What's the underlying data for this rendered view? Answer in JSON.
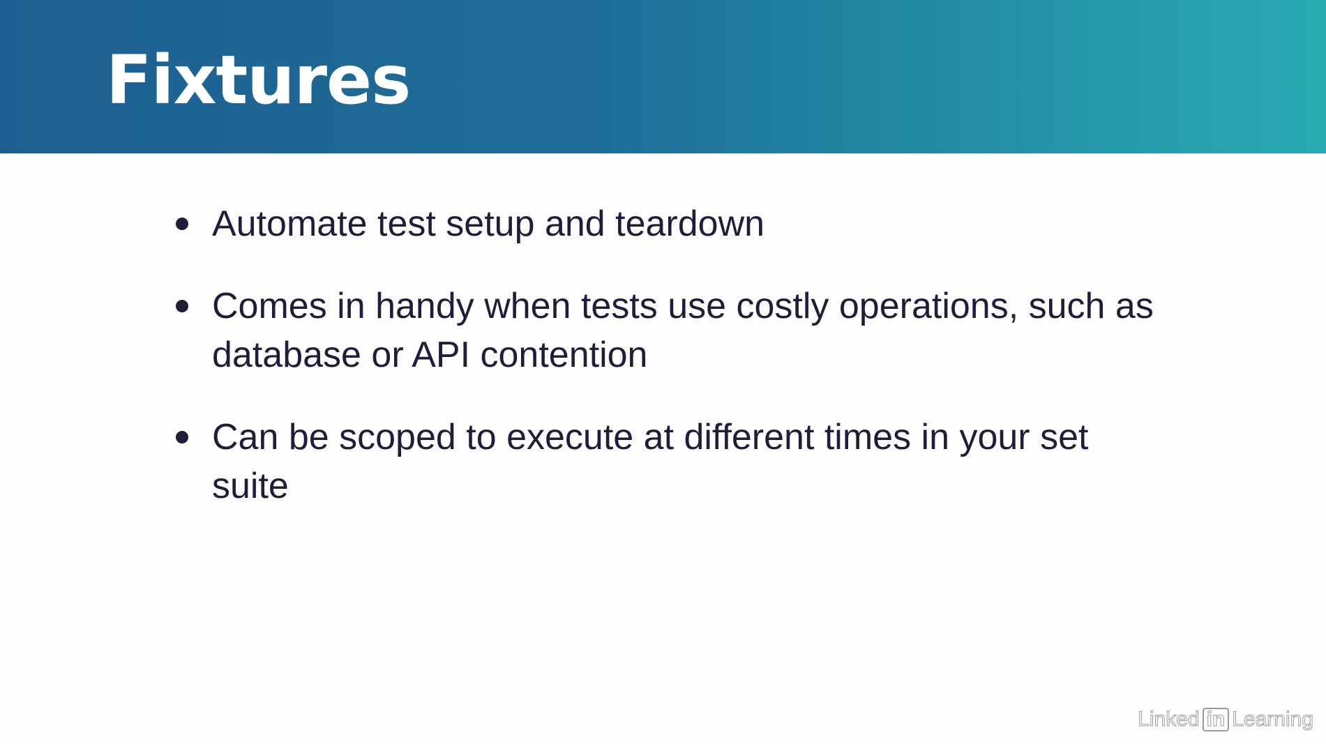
{
  "slide": {
    "title": "Fixtures",
    "bullets": [
      "Automate test setup and teardown",
      "Comes in handy when tests use costly operations, such as database or API contention",
      "Can be scoped to execute at different times in your set suite"
    ]
  },
  "watermark": {
    "left": "Linked",
    "box": "in",
    "right": "Learning"
  },
  "colors": {
    "header_start": "#1d5f92",
    "header_end": "#2aaab3",
    "title": "#ffffff",
    "body_text": "#1e1d3a",
    "background": "#fdfdfd"
  }
}
